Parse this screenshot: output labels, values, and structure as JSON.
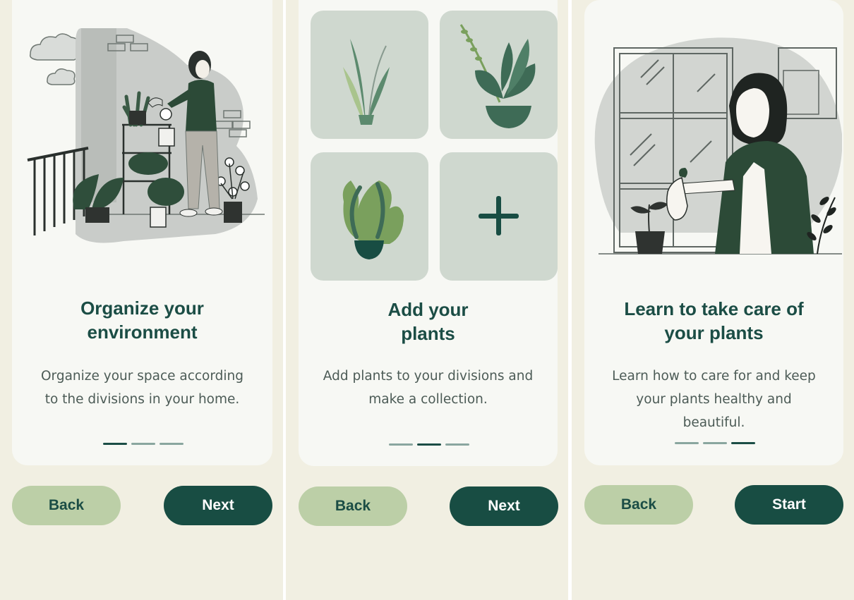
{
  "screens": [
    {
      "title_line1": "Organize your",
      "title_line2": "environment",
      "desc_line1": "Organize your space according",
      "desc_line2": "to the divisions in your home.",
      "back_label": "Back",
      "next_label": "Next",
      "active_step": 1
    },
    {
      "title_line1": "Add your",
      "title_line2": "plants",
      "desc_line1": "Add plants to your divisions and",
      "desc_line2": "make a collection.",
      "back_label": "Back",
      "next_label": "Next",
      "active_step": 2,
      "add_tile_icon": "plus-icon"
    },
    {
      "title_line1": "Learn to take care of",
      "title_line2": "your plants",
      "desc_line1": "Learn how to care for and keep",
      "desc_line2": "your plants healthy and",
      "desc_line3": "beautiful.",
      "back_label": "Back",
      "next_label": "Start",
      "active_step": 3
    }
  ],
  "colors": {
    "background": "#f1efe2",
    "card": "#f7f8f4",
    "primary": "#184d43",
    "secondary": "#bccfa7",
    "text": "#4c5b56",
    "indicator_inactive": "#8aa69f"
  }
}
